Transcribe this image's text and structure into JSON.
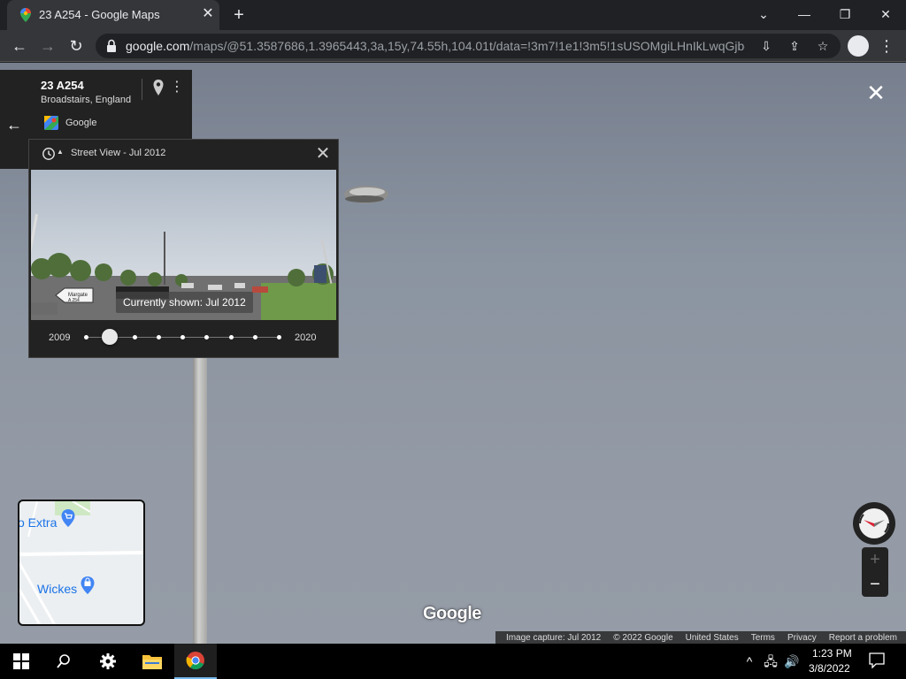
{
  "browser": {
    "tab_title": "23 A254 - Google Maps",
    "tab_close": "✕",
    "new_tab": "+",
    "window_controls": {
      "collapse": "⌄",
      "minimize": "—",
      "restore": "❐",
      "close": "✕"
    },
    "nav": {
      "back": "←",
      "forward": "→",
      "reload": "↻"
    },
    "url_domain": "google.com",
    "url_path": "/maps/@51.3587686,1.3965443,3a,15y,74.55h,104.01t/data=!3m7!1e1!3m5!1sUSOMgiLHnIkLwqGjbg...",
    "icons": [
      "install-icon",
      "share-icon",
      "bookmark-star-icon",
      "profile-icon",
      "menu-icon"
    ]
  },
  "place_card": {
    "name": "23 A254",
    "locality": "Broadstairs, England",
    "source": "Google"
  },
  "time_machine": {
    "title": "Street View - Jul 2012",
    "currently_shown": "Currently shown: Jul 2012",
    "year_start": "2009",
    "year_end": "2020",
    "selected_index": 1,
    "stop_count": 9,
    "photo_signs": [
      "Margate",
      "A 254"
    ]
  },
  "minimap": {
    "labels": [
      "o Extra",
      "Wickes"
    ]
  },
  "controls": {
    "close": "✕",
    "back": "←",
    "zoom_in": "+",
    "zoom_out": "−"
  },
  "watermark": "Google",
  "footer": {
    "capture": "Image capture: Jul 2012",
    "copyright": "© 2022 Google",
    "country": "United States",
    "terms": "Terms",
    "privacy": "Privacy",
    "report": "Report a problem"
  },
  "taskbar": {
    "time": "1:23 PM",
    "date": "3/8/2022",
    "apps": [
      "start-icon",
      "search-icon",
      "settings-icon",
      "file-explorer-icon",
      "chrome-icon"
    ]
  },
  "colors": {
    "accent": "#1a73e8",
    "panel": "#222222",
    "taskbar_highlight": "#76b9ed"
  }
}
